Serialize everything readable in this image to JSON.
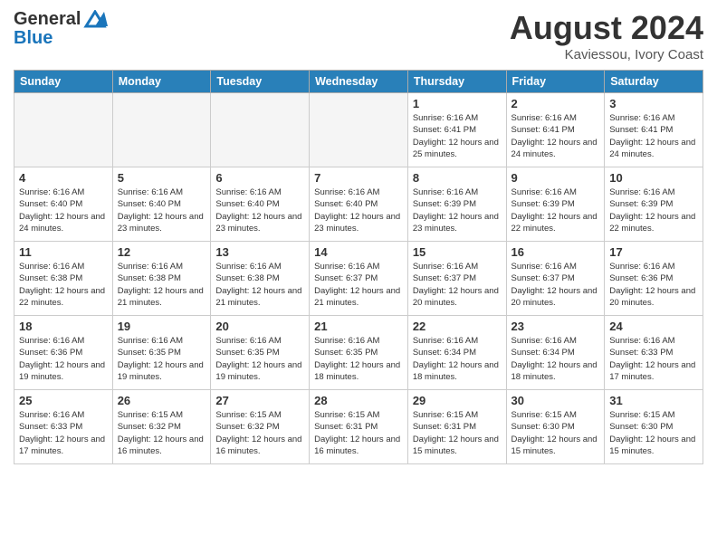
{
  "logo": {
    "line1": "General",
    "line2": "Blue"
  },
  "title": "August 2024",
  "location": "Kaviessou, Ivory Coast",
  "days_of_week": [
    "Sunday",
    "Monday",
    "Tuesday",
    "Wednesday",
    "Thursday",
    "Friday",
    "Saturday"
  ],
  "weeks": [
    [
      {
        "day": "",
        "info": ""
      },
      {
        "day": "",
        "info": ""
      },
      {
        "day": "",
        "info": ""
      },
      {
        "day": "",
        "info": ""
      },
      {
        "day": "1",
        "info": "Sunrise: 6:16 AM\nSunset: 6:41 PM\nDaylight: 12 hours\nand 25 minutes."
      },
      {
        "day": "2",
        "info": "Sunrise: 6:16 AM\nSunset: 6:41 PM\nDaylight: 12 hours\nand 24 minutes."
      },
      {
        "day": "3",
        "info": "Sunrise: 6:16 AM\nSunset: 6:41 PM\nDaylight: 12 hours\nand 24 minutes."
      }
    ],
    [
      {
        "day": "4",
        "info": "Sunrise: 6:16 AM\nSunset: 6:40 PM\nDaylight: 12 hours\nand 24 minutes."
      },
      {
        "day": "5",
        "info": "Sunrise: 6:16 AM\nSunset: 6:40 PM\nDaylight: 12 hours\nand 23 minutes."
      },
      {
        "day": "6",
        "info": "Sunrise: 6:16 AM\nSunset: 6:40 PM\nDaylight: 12 hours\nand 23 minutes."
      },
      {
        "day": "7",
        "info": "Sunrise: 6:16 AM\nSunset: 6:40 PM\nDaylight: 12 hours\nand 23 minutes."
      },
      {
        "day": "8",
        "info": "Sunrise: 6:16 AM\nSunset: 6:39 PM\nDaylight: 12 hours\nand 23 minutes."
      },
      {
        "day": "9",
        "info": "Sunrise: 6:16 AM\nSunset: 6:39 PM\nDaylight: 12 hours\nand 22 minutes."
      },
      {
        "day": "10",
        "info": "Sunrise: 6:16 AM\nSunset: 6:39 PM\nDaylight: 12 hours\nand 22 minutes."
      }
    ],
    [
      {
        "day": "11",
        "info": "Sunrise: 6:16 AM\nSunset: 6:38 PM\nDaylight: 12 hours\nand 22 minutes."
      },
      {
        "day": "12",
        "info": "Sunrise: 6:16 AM\nSunset: 6:38 PM\nDaylight: 12 hours\nand 21 minutes."
      },
      {
        "day": "13",
        "info": "Sunrise: 6:16 AM\nSunset: 6:38 PM\nDaylight: 12 hours\nand 21 minutes."
      },
      {
        "day": "14",
        "info": "Sunrise: 6:16 AM\nSunset: 6:37 PM\nDaylight: 12 hours\nand 21 minutes."
      },
      {
        "day": "15",
        "info": "Sunrise: 6:16 AM\nSunset: 6:37 PM\nDaylight: 12 hours\nand 20 minutes."
      },
      {
        "day": "16",
        "info": "Sunrise: 6:16 AM\nSunset: 6:37 PM\nDaylight: 12 hours\nand 20 minutes."
      },
      {
        "day": "17",
        "info": "Sunrise: 6:16 AM\nSunset: 6:36 PM\nDaylight: 12 hours\nand 20 minutes."
      }
    ],
    [
      {
        "day": "18",
        "info": "Sunrise: 6:16 AM\nSunset: 6:36 PM\nDaylight: 12 hours\nand 19 minutes."
      },
      {
        "day": "19",
        "info": "Sunrise: 6:16 AM\nSunset: 6:35 PM\nDaylight: 12 hours\nand 19 minutes."
      },
      {
        "day": "20",
        "info": "Sunrise: 6:16 AM\nSunset: 6:35 PM\nDaylight: 12 hours\nand 19 minutes."
      },
      {
        "day": "21",
        "info": "Sunrise: 6:16 AM\nSunset: 6:35 PM\nDaylight: 12 hours\nand 18 minutes."
      },
      {
        "day": "22",
        "info": "Sunrise: 6:16 AM\nSunset: 6:34 PM\nDaylight: 12 hours\nand 18 minutes."
      },
      {
        "day": "23",
        "info": "Sunrise: 6:16 AM\nSunset: 6:34 PM\nDaylight: 12 hours\nand 18 minutes."
      },
      {
        "day": "24",
        "info": "Sunrise: 6:16 AM\nSunset: 6:33 PM\nDaylight: 12 hours\nand 17 minutes."
      }
    ],
    [
      {
        "day": "25",
        "info": "Sunrise: 6:16 AM\nSunset: 6:33 PM\nDaylight: 12 hours\nand 17 minutes."
      },
      {
        "day": "26",
        "info": "Sunrise: 6:15 AM\nSunset: 6:32 PM\nDaylight: 12 hours\nand 16 minutes."
      },
      {
        "day": "27",
        "info": "Sunrise: 6:15 AM\nSunset: 6:32 PM\nDaylight: 12 hours\nand 16 minutes."
      },
      {
        "day": "28",
        "info": "Sunrise: 6:15 AM\nSunset: 6:31 PM\nDaylight: 12 hours\nand 16 minutes."
      },
      {
        "day": "29",
        "info": "Sunrise: 6:15 AM\nSunset: 6:31 PM\nDaylight: 12 hours\nand 15 minutes."
      },
      {
        "day": "30",
        "info": "Sunrise: 6:15 AM\nSunset: 6:30 PM\nDaylight: 12 hours\nand 15 minutes."
      },
      {
        "day": "31",
        "info": "Sunrise: 6:15 AM\nSunset: 6:30 PM\nDaylight: 12 hours\nand 15 minutes."
      }
    ]
  ]
}
